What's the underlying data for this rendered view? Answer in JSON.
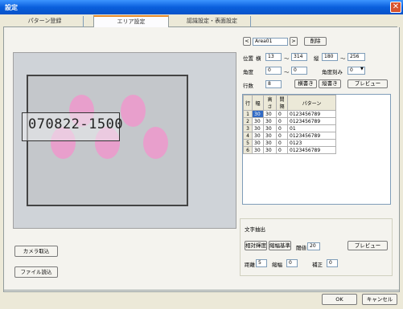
{
  "window": {
    "title": "設定"
  },
  "tabs": [
    {
      "label": "パターン登録"
    },
    {
      "label": "エリア設定"
    },
    {
      "label": "認識設定・表面設定"
    }
  ],
  "preview": {
    "ocr_text": "070822-1500"
  },
  "area": {
    "prev": "<",
    "name": "Area01",
    "next": ">",
    "delete": "削除"
  },
  "position": {
    "label": "位置",
    "x_label": "横",
    "x_from": "13",
    "x_to": "314",
    "y_label": "縦",
    "y_from": "180",
    "y_to": "256"
  },
  "angle": {
    "label": "角度",
    "from": "0",
    "to": "0",
    "step_label": "角度刻み",
    "step": "0"
  },
  "count": {
    "label": "行数",
    "value": "8",
    "horiz": "横書き",
    "vert": "縦書き",
    "preview": "プレビュー"
  },
  "grid": {
    "headers": [
      "行",
      "幅",
      "高さ",
      "間隔",
      "パターン"
    ],
    "rows": [
      [
        "1",
        "30",
        "30",
        "0",
        "0123456789"
      ],
      [
        "2",
        "30",
        "30",
        "0",
        "0123456789"
      ],
      [
        "3",
        "30",
        "30",
        "0",
        "01"
      ],
      [
        "4",
        "30",
        "30",
        "0",
        "0123456789"
      ],
      [
        "5",
        "30",
        "30",
        "0",
        "0123"
      ],
      [
        "6",
        "30",
        "30",
        "0",
        "0123456789"
      ]
    ]
  },
  "extract": {
    "title": "文字抽出",
    "relative": "相対輝度",
    "binarize": "縮幅基準",
    "threshold_label": "閾値",
    "threshold": "20",
    "preview": "プレビュー",
    "distance_label": "距離",
    "distance": "5",
    "shrink_label": "縮幅",
    "shrink": "0",
    "correct_label": "補正",
    "correct": "0"
  },
  "left_buttons": {
    "camera": "カメラ取込",
    "file": "ファイル読込"
  },
  "footer": {
    "ok": "OK",
    "cancel": "キャンセル"
  }
}
